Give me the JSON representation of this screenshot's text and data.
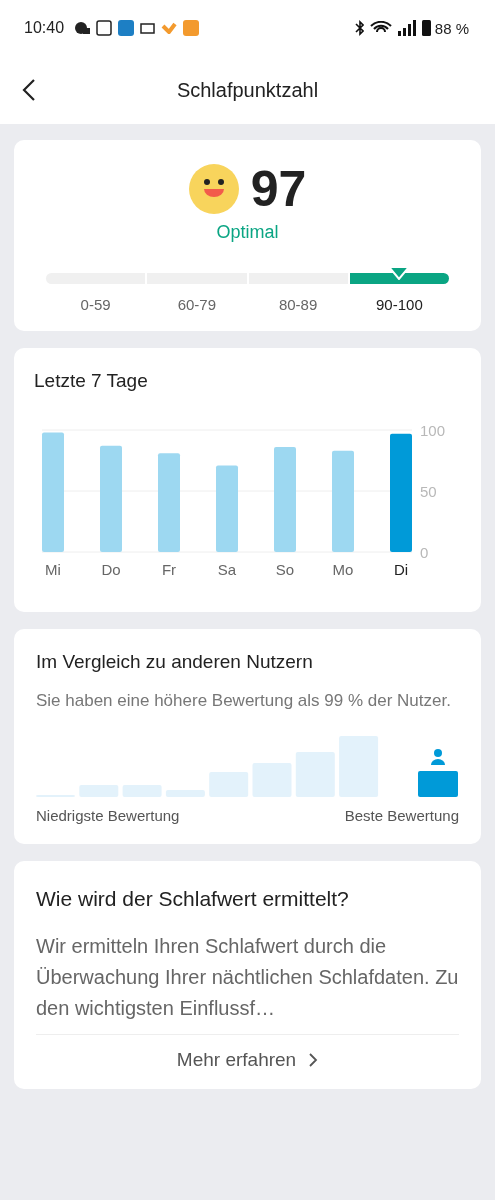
{
  "status_bar": {
    "time": "10:40",
    "battery": "88 %"
  },
  "header": {
    "title": "Schlafpunktzahl"
  },
  "score": {
    "value": "97",
    "rating": "Optimal",
    "ranges": [
      {
        "label": "0-59",
        "selected": false
      },
      {
        "label": "60-79",
        "selected": false
      },
      {
        "label": "80-89",
        "selected": false
      },
      {
        "label": "90-100",
        "selected": true
      }
    ]
  },
  "last_7_days": {
    "title": "Letzte 7 Tage",
    "chart_data": {
      "type": "bar",
      "categories": [
        "Mi",
        "Do",
        "Fr",
        "Sa",
        "So",
        "Mo",
        "Di"
      ],
      "series": [
        {
          "color": "#9dd8f1",
          "values": [
            98,
            87,
            81,
            71,
            86,
            83,
            null
          ]
        },
        {
          "color": "#009ad8",
          "values": [
            null,
            null,
            null,
            null,
            null,
            null,
            97
          ]
        }
      ],
      "ylim": [
        0,
        100
      ],
      "yticks": [
        0,
        50,
        100
      ]
    }
  },
  "comparison": {
    "title": "Im Vergleich zu anderen Nutzern",
    "text": "Sie haben eine höhere Bewertung als 99 % der Nutzer.",
    "low_label": "Niedrigste Bewertung",
    "high_label": "Beste Bewertung"
  },
  "info": {
    "title": "Wie wird der Schlafwert ermittelt?",
    "text": "Wir ermitteln Ihren Schlafwert durch die Überwachung Ihrer nächtlichen Schlafdaten. Zu den wichtigsten Einflussf…",
    "link": "Mehr erfahren"
  }
}
